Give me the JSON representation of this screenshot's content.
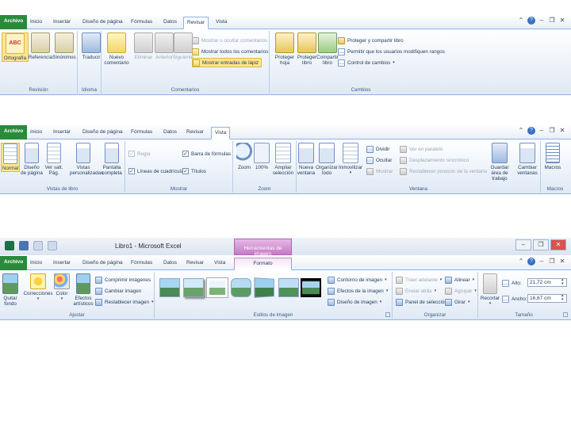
{
  "ribbon1": {
    "tabs": [
      "Archivo",
      "Inicio",
      "Insertar",
      "Diseño de página",
      "Fórmulas",
      "Datos",
      "Revisar",
      "Vista"
    ],
    "active_tab": "Revisar",
    "groups": {
      "revision": {
        "label": "Revisión",
        "buttons": [
          "Ortografía",
          "Referencia",
          "Sinónimos"
        ]
      },
      "idioma": {
        "label": "Idioma",
        "buttons": [
          "Traducir"
        ]
      },
      "comentarios": {
        "label": "Comentarios",
        "new_comment": "Nuevo comentario",
        "delete": "Eliminar",
        "previous": "Anterior",
        "next": "Siguiente",
        "show_hide": "Mostrar u ocultar comentarios",
        "show_all": "Mostrar todos los comentarios",
        "show_ink": "Mostrar entradas de lápiz"
      },
      "cambios": {
        "label": "Cambios",
        "protect_sheet": "Proteger hoja",
        "protect_book": "Proteger libro",
        "share_book": "Compartir libro",
        "protect_share": "Proteger y compartir libro",
        "allow_ranges": "Permitir que los usuarios modifiquen rangos",
        "track_changes": "Control de cambios"
      }
    }
  },
  "ribbon2": {
    "tabs": [
      "Archivo",
      "Inicio",
      "Insertar",
      "Diseño de página",
      "Fórmulas",
      "Datos",
      "Revisar",
      "Vista"
    ],
    "active_tab": "Vista",
    "groups": {
      "vistas": {
        "label": "Vistas de libro",
        "normal": "Normal",
        "page_layout": "Diseño de página",
        "page_break": "Ver salt. Pág.",
        "custom_views": "Vistas personalizadas",
        "full_screen": "Pantalla completa"
      },
      "mostrar": {
        "label": "Mostrar",
        "ruler": "Regla",
        "formula_bar": "Barra de fórmulas",
        "gridlines": "Líneas de cuadrícula",
        "headings": "Títulos"
      },
      "zoom": {
        "label": "Zoom",
        "zoom": "Zoom",
        "zoom100": "100%",
        "zoom_sel": "Ampliar selección"
      },
      "ventana": {
        "label": "Ventana",
        "new_window": "Nueva ventana",
        "arrange": "Organizar todo",
        "freeze": "Inmovilizar",
        "split": "Dividir",
        "hide": "Ocultar",
        "unhide": "Mostrar",
        "side_by_side": "Ver en paralelo",
        "sync_scroll": "Desplazamiento sincrónico",
        "reset_pos": "Restablecer posición de la ventana",
        "save_workspace": "Guardar área de trabajo",
        "switch": "Cambiar ventanas"
      },
      "macros": {
        "label": "Macros",
        "macros": "Macros"
      }
    }
  },
  "ribbon3": {
    "title": "Libro1 - Microsoft Excel",
    "context_header": "Herramientas de imagen",
    "tabs": [
      "Archivo",
      "Inicio",
      "Insertar",
      "Diseño de página",
      "Fórmulas",
      "Datos",
      "Revisar",
      "Vista",
      "Formato"
    ],
    "active_tab": "Formato",
    "groups": {
      "ajustar": {
        "label": "Ajustar",
        "remove_bg": "Quitar fondo",
        "corrections": "Correcciones",
        "color": "Color",
        "artistic": "Efectos artísticos",
        "compress": "Comprimir imágenes",
        "change": "Cambiar imagen",
        "reset": "Restablecer imagen"
      },
      "estilos": {
        "label": "Estilos de imagen",
        "border": "Contorno de imagen",
        "effects": "Efectos de la imagen",
        "layout": "Diseño de imagen"
      },
      "organizar": {
        "label": "Organizar",
        "bring_forward": "Traer adelante",
        "send_backward": "Enviar atrás",
        "selection_pane": "Panel de selección",
        "align": "Alinear",
        "group": "Agrupar",
        "rotate": "Girar"
      },
      "tamano": {
        "label": "Tamaño",
        "crop": "Recortar",
        "height_label": "Alto:",
        "height_value": "21,72 cm",
        "width_label": "Ancho:",
        "width_value": "16,67 cm"
      }
    }
  },
  "colors": {
    "file_tab": "#2a8a3b",
    "ribbon_bg": "#dfe9f5",
    "selected": "#fde58c",
    "context_tab": "#c77ac7"
  }
}
